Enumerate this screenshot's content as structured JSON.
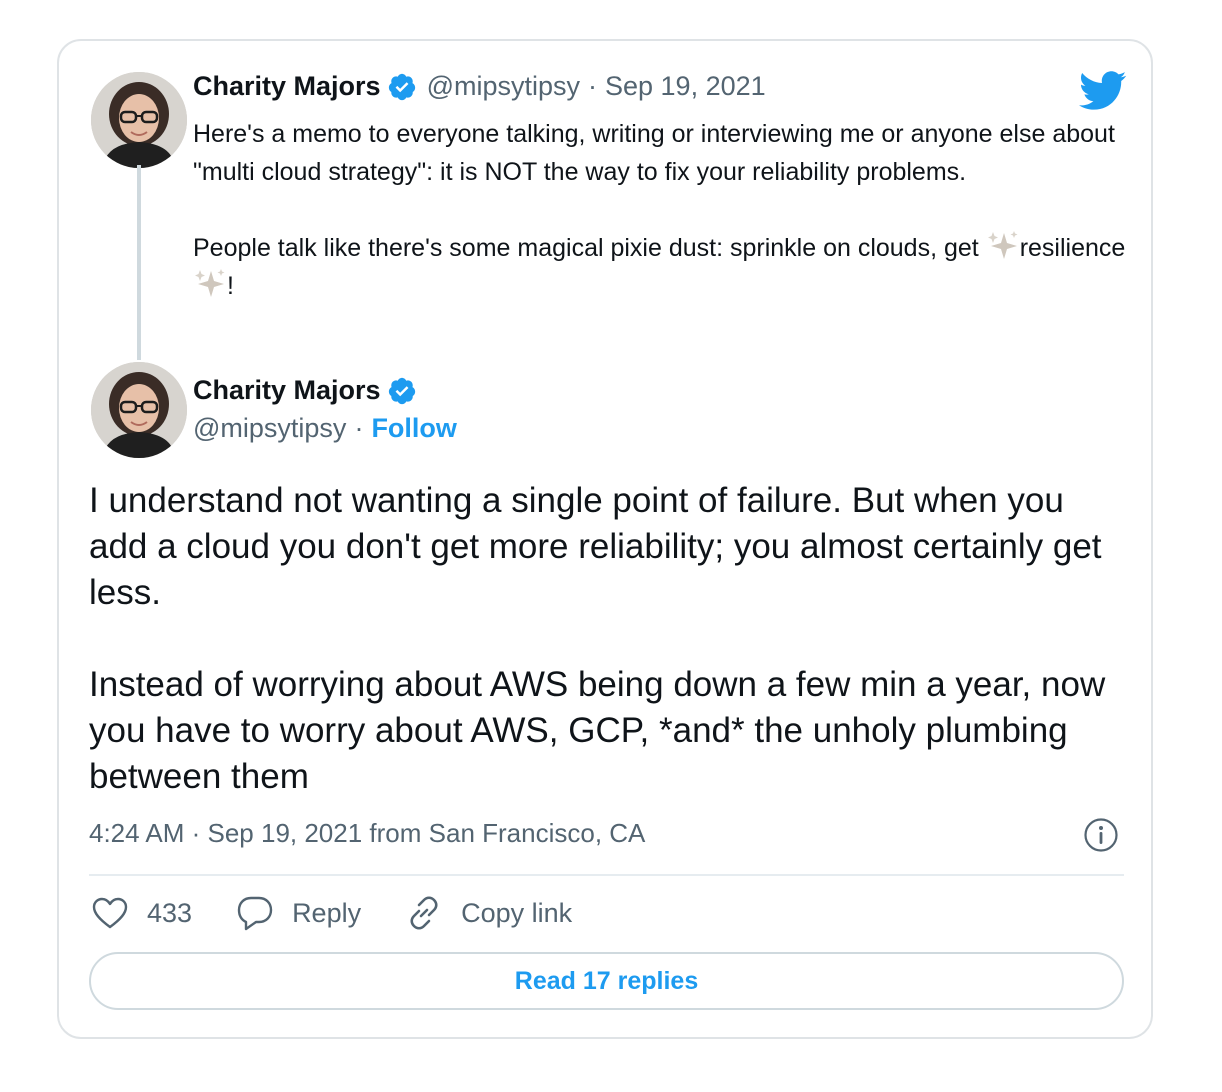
{
  "quoted_tweet": {
    "author_name": "Charity Majors",
    "handle": "@mipsytipsy",
    "separator": "·",
    "date": "Sep 19, 2021",
    "paragraph1": "Here's a memo to everyone talking, writing or interviewing me or anyone else about \"multi cloud strategy\": it is NOT the way to fix your reliability problems.",
    "paragraph2_before": "People talk like there's some magical pixie dust: sprinkle on clouds, get ",
    "paragraph2_middle": "resilience",
    "paragraph2_after": "!"
  },
  "main_tweet": {
    "author_name": "Charity Majors",
    "handle": "@mipsytipsy",
    "separator": "·",
    "follow_label": "Follow",
    "paragraph1": "I understand not wanting a single point of failure. But when you add a cloud you don't get more reliability; you almost certainly get less.",
    "paragraph2": "Instead of worrying about AWS being down a few min a year, now you have to worry about AWS, GCP, *and* the unholy plumbing between them",
    "timestamp": "4:24 AM · Sep 19, 2021 from San Francisco, CA"
  },
  "actions": {
    "like_count": "433",
    "reply_label": "Reply",
    "copy_link_label": "Copy link"
  },
  "read_replies_label": "Read 17 replies",
  "icons": {
    "brand": "twitter-bird-icon",
    "verified": "verified-badge-icon",
    "info": "info-icon",
    "like": "heart-icon",
    "reply": "speech-bubble-icon",
    "copy": "link-icon",
    "sparkles": "sparkles-icon"
  },
  "colors": {
    "accent": "#1d9bf0",
    "text": "#0f1419",
    "secondary": "#536471",
    "border": "#dfe3e6"
  }
}
